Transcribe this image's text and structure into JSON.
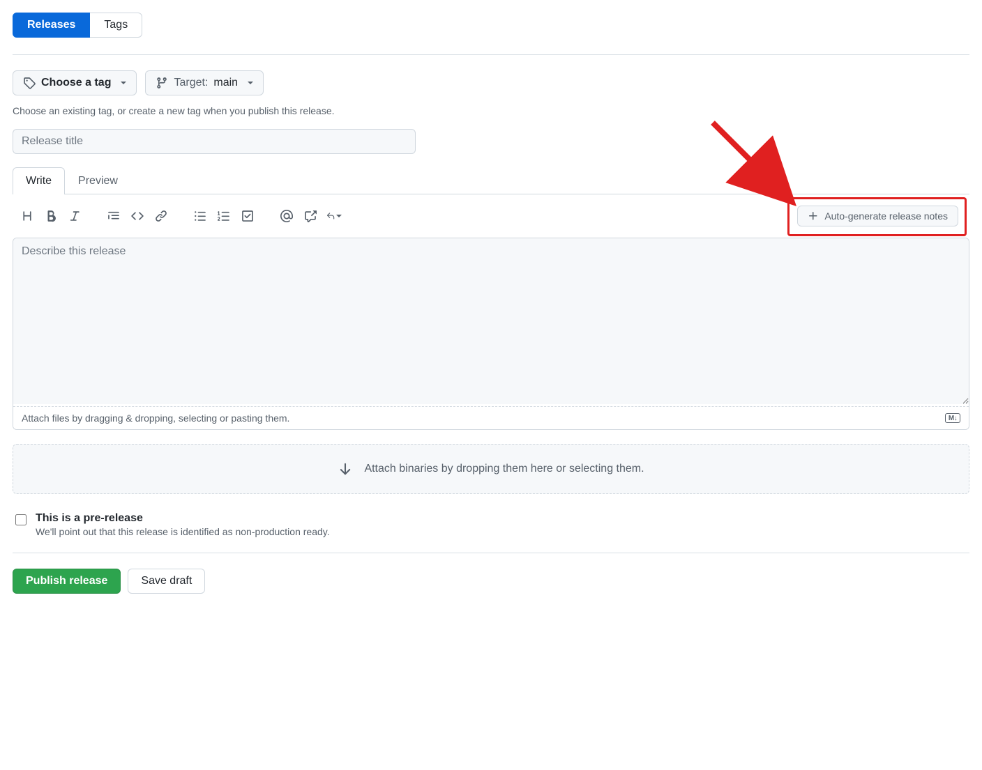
{
  "nav": {
    "releases": "Releases",
    "tags": "Tags"
  },
  "tag_selector": {
    "choose_tag": "Choose a tag",
    "target_label": "Target:",
    "target_value": "main",
    "hint": "Choose an existing tag, or create a new tag when you publish this release."
  },
  "title": {
    "placeholder": "Release title",
    "value": ""
  },
  "editor": {
    "tabs": {
      "write": "Write",
      "preview": "Preview"
    },
    "autogen": "Auto-generate release notes",
    "textarea_placeholder": "Describe this release",
    "textarea_value": "",
    "attach_hint": "Attach files by dragging & dropping, selecting or pasting them.",
    "md_badge": "M↓"
  },
  "binaries": {
    "text": "Attach binaries by dropping them here or selecting them."
  },
  "prerelease": {
    "label": "This is a pre-release",
    "desc": "We'll point out that this release is identified as non-production ready."
  },
  "footer": {
    "publish": "Publish release",
    "save_draft": "Save draft"
  }
}
